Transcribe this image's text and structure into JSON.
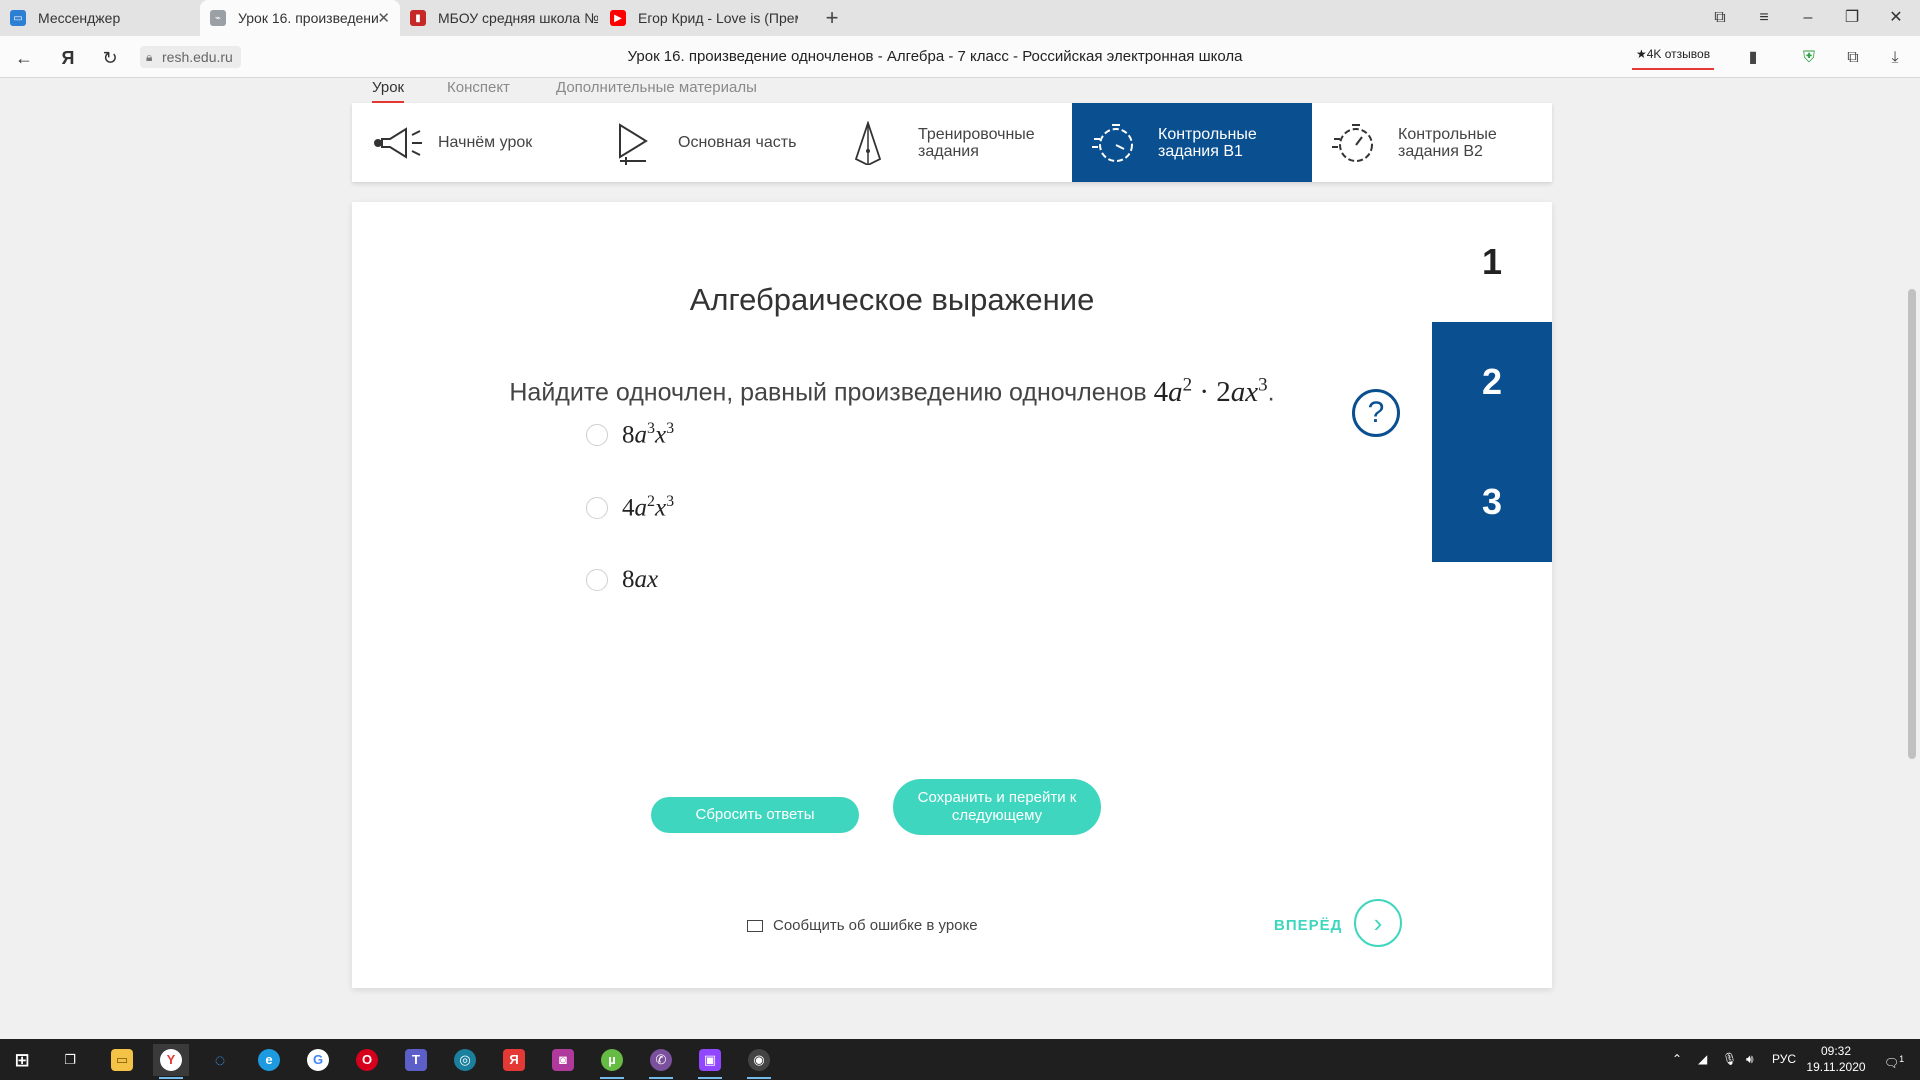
{
  "browser": {
    "tabs": [
      {
        "label": "Мессенджер",
        "favicon_color": "#2d7fd3",
        "active": false
      },
      {
        "label": "Урок 16. произведение",
        "favicon_color": "#9aa0a6",
        "active": true
      },
      {
        "label": "МБОУ средняя школа №",
        "favicon_color": "#c62828",
        "active": false
      },
      {
        "label": "Егор Крид - Love is (Прем",
        "favicon_color": "#ff0000",
        "active": false
      }
    ],
    "tab_close_glyph": "✕",
    "new_tab_glyph": "+",
    "url": "resh.edu.ru",
    "page_title": "Урок 16. произведение одночленов - Алгебра - 7 класс - Российская электронная школа",
    "reviews_badge": "★4K отзывов",
    "yandex_glyph": "Я",
    "accent_color": "#e53935"
  },
  "lesson_tabs": [
    {
      "label": "Урок",
      "active": true
    },
    {
      "label": "Конспект",
      "active": false
    },
    {
      "label": "Дополнительные материалы",
      "active": false
    }
  ],
  "steps": [
    {
      "label": "Начнём урок",
      "icon": "megaphone-icon",
      "active": false
    },
    {
      "label": "Основная часть",
      "icon": "play-board-icon",
      "active": false
    },
    {
      "label": "Тренировочные задания",
      "icon": "pyramid-icon",
      "active": false
    },
    {
      "label": "Контрольные задания В1",
      "icon": "stopwatch-icon",
      "active": true
    },
    {
      "label": "Контрольные задания В2",
      "icon": "stopwatch-icon",
      "active": false
    }
  ],
  "question": {
    "title": "Алгебраическое выражение",
    "prompt": "Найдите одночлен, равный произведению одночленов ",
    "expression": {
      "c1": "4",
      "v1": "a",
      "e1": "2",
      "dot": "·",
      "c2": "2",
      "v2": "ax",
      "e2": "3",
      "period": "."
    },
    "help_glyph": "?",
    "options": [
      {
        "coef": "8",
        "v1": "a",
        "e1": "3",
        "v2": "x",
        "e2": "3"
      },
      {
        "coef": "4",
        "v1": "a",
        "e1": "2",
        "v2": "x",
        "e2": "3"
      },
      {
        "coef": "8",
        "v1": "ax",
        "e1": "",
        "v2": "",
        "e2": ""
      }
    ]
  },
  "question_numbers": [
    "1",
    "2",
    "3"
  ],
  "buttons": {
    "reset": "Сбросить ответы",
    "save_next": "Сохранить и перейти к следующему"
  },
  "report_link": "Сообщить об ошибке в уроке",
  "forward": {
    "label": "ВПЕРЁД",
    "glyph": "›"
  },
  "colors": {
    "primary": "#0a4f8f",
    "teal": "#3fd6bf"
  },
  "taskbar": {
    "apps": [
      "windows-start",
      "task-view",
      "file-explorer",
      "yandex-browser",
      "cortana",
      "edge",
      "google-chrome",
      "opera",
      "teams",
      "app-blue",
      "yandex",
      "app-pink",
      "utorrent",
      "viber",
      "twitch",
      "app-circle"
    ],
    "language": "РУС",
    "time": "09:32",
    "date": "19.11.2020",
    "notification_count": "1"
  }
}
